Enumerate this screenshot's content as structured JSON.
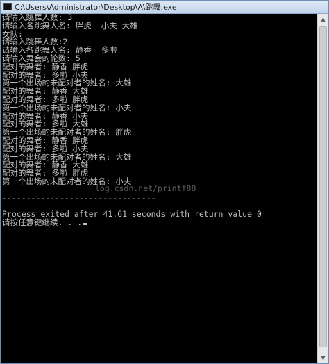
{
  "window": {
    "title": "C:\\Users\\Administrator\\Desktop\\A\\跳舞.exe",
    "icon": "console-icon"
  },
  "console": {
    "lines": [
      "请输入跳舞人数: 3",
      "请输入各跳舞人名: 胖虎  小夫 大雄",
      "女队:",
      "请输入跳舞人数:2",
      "请输入各跳舞人名: 静香  多啦",
      "请输入舞会的轮数: 5",
      "配对的舞者: 静香 胖虎",
      "配对的舞者: 多啦 小夫",
      "第一个出场的未配对者的姓名: 大雄",
      "配对的舞者: 静香 大雄",
      "配对的舞者: 多啦 胖虎",
      "第一个出场的未配对者的姓名: 小夫",
      "配对的舞者: 静香 小夫",
      "配对的舞者: 多啦 大雄",
      "第一个出场的未配对者的姓名: 胖虎",
      "配对的舞者: 静香 胖虎",
      "配对的舞者: 多啦 小夫",
      "第一个出场的未配对者的姓名: 大雄",
      "配对的舞者: 静香 大雄",
      "配对的舞者: 多啦 胖虎",
      "第一个出场的未配对者的姓名: 小夫",
      "",
      "--------------------------------",
      "",
      "Process exited after 41.61 seconds with return value 0",
      "请按任意键继续. . ."
    ],
    "watermark": "log.csdn.net/printf88"
  },
  "scrollbar": {
    "up_icon": "scroll-up-arrow-icon",
    "down_icon": "scroll-down-arrow-icon"
  }
}
